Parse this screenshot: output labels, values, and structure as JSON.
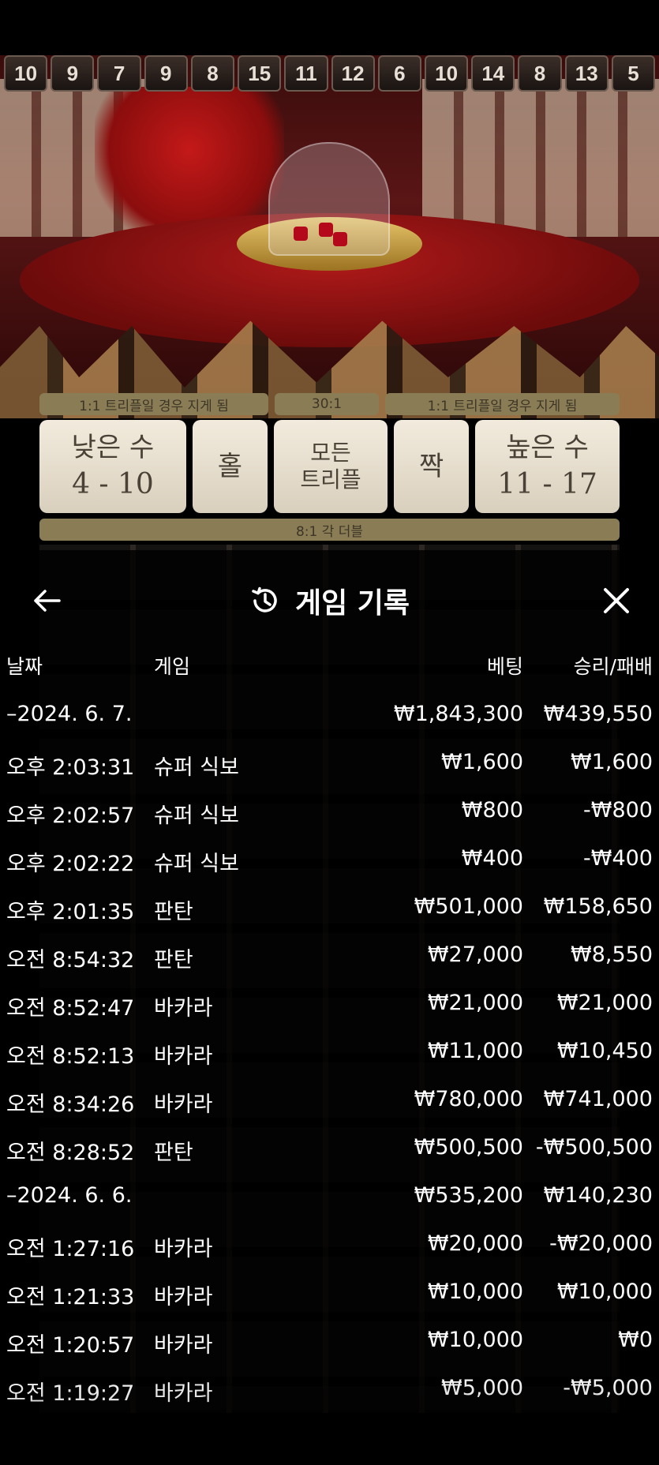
{
  "history_numbers": [
    "10",
    "9",
    "7",
    "9",
    "8",
    "15",
    "11",
    "12",
    "6",
    "10",
    "14",
    "8",
    "13",
    "5"
  ],
  "payouts": {
    "low_triple": "1:1 트리플일 경우 지게 됨",
    "any_triple": "30:1",
    "high_triple": "1:1 트리플일 경우 지게 됨",
    "each_double": "8:1 각 더블"
  },
  "bets": {
    "low": {
      "label": "낮은 수",
      "range": "4 - 10"
    },
    "odd": {
      "label": "홀"
    },
    "any_triple": {
      "line1": "모든",
      "line2": "트리플"
    },
    "even": {
      "label": "짝"
    },
    "high": {
      "label": "높은 수",
      "range": "11 - 17"
    }
  },
  "panel": {
    "title": "게임 기록",
    "back_icon": "arrow-left-icon",
    "history_icon": "history-clock-icon",
    "close_icon": "close-icon",
    "columns": {
      "date": "날짜",
      "game": "게임",
      "bet": "베팅",
      "winloss": "승리/패배"
    }
  },
  "groups": [
    {
      "date": "–2024. 6. 7.",
      "bet_total": "₩1,843,300",
      "win_total": "₩439,550",
      "rows": [
        {
          "time": "오후 2:03:31",
          "game": "슈퍼 식보",
          "bet": "₩1,600",
          "win": "₩1,600"
        },
        {
          "time": "오후 2:02:57",
          "game": "슈퍼 식보",
          "bet": "₩800",
          "win": "-₩800"
        },
        {
          "time": "오후 2:02:22",
          "game": "슈퍼 식보",
          "bet": "₩400",
          "win": "-₩400"
        },
        {
          "time": "오후 2:01:35",
          "game": "판탄",
          "bet": "₩501,000",
          "win": "₩158,650"
        },
        {
          "time": "오전 8:54:32",
          "game": "판탄",
          "bet": "₩27,000",
          "win": "₩8,550"
        },
        {
          "time": "오전 8:52:47",
          "game": "바카라",
          "bet": "₩21,000",
          "win": "₩21,000"
        },
        {
          "time": "오전 8:52:13",
          "game": "바카라",
          "bet": "₩11,000",
          "win": "₩10,450"
        },
        {
          "time": "오전 8:34:26",
          "game": "바카라",
          "bet": "₩780,000",
          "win": "₩741,000"
        },
        {
          "time": "오전 8:28:52",
          "game": "판탄",
          "bet": "₩500,500",
          "win": "-₩500,500"
        }
      ]
    },
    {
      "date": "–2024. 6. 6.",
      "bet_total": "₩535,200",
      "win_total": "₩140,230",
      "rows": [
        {
          "time": "오전 1:27:16",
          "game": "바카라",
          "bet": "₩20,000",
          "win": "-₩20,000"
        },
        {
          "time": "오전 1:21:33",
          "game": "바카라",
          "bet": "₩10,000",
          "win": "₩10,000"
        },
        {
          "time": "오전 1:20:57",
          "game": "바카라",
          "bet": "₩10,000",
          "win": "₩0"
        },
        {
          "time": "오전 1:19:27",
          "game": "바카라",
          "bet": "₩5,000",
          "win": "-₩5,000"
        }
      ]
    }
  ]
}
